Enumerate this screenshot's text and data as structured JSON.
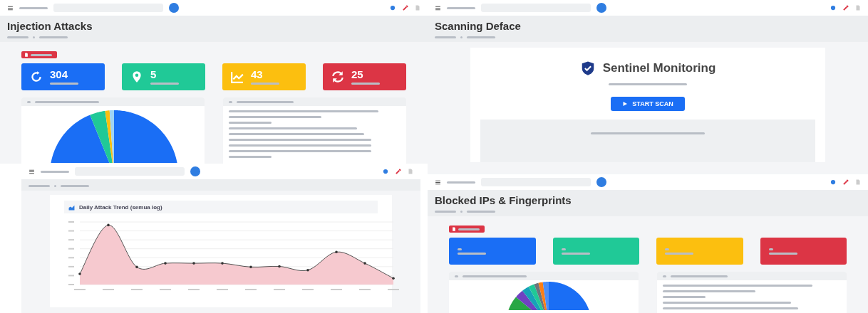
{
  "screens": [
    {
      "kind": "stats",
      "title": "Injection Attacks",
      "stats": [
        {
          "kind": "large",
          "value": "304",
          "color": "#1a6ef5"
        },
        {
          "kind": "large",
          "value": "5",
          "color": "#20c997"
        },
        {
          "kind": "large",
          "value": "43",
          "color": "#fcbf0f"
        },
        {
          "kind": "large",
          "value": "25",
          "color": "#dc3545"
        }
      ]
    },
    {
      "kind": "scan",
      "title": "Scanning Deface",
      "brand": "Sentinel Monitoring",
      "button": "START SCAN"
    },
    {
      "kind": "trend",
      "chart_title": "Daily Attack Trend (semua log)"
    },
    {
      "kind": "stats",
      "title": "Blocked IPs & Fingerprints",
      "stats": [
        {
          "kind": "compact",
          "color": "#1a6ef5"
        },
        {
          "kind": "compact",
          "color": "#20c997"
        },
        {
          "kind": "compact",
          "color": "#fcbf0f"
        },
        {
          "kind": "compact",
          "color": "#dc3545"
        }
      ]
    }
  ]
}
